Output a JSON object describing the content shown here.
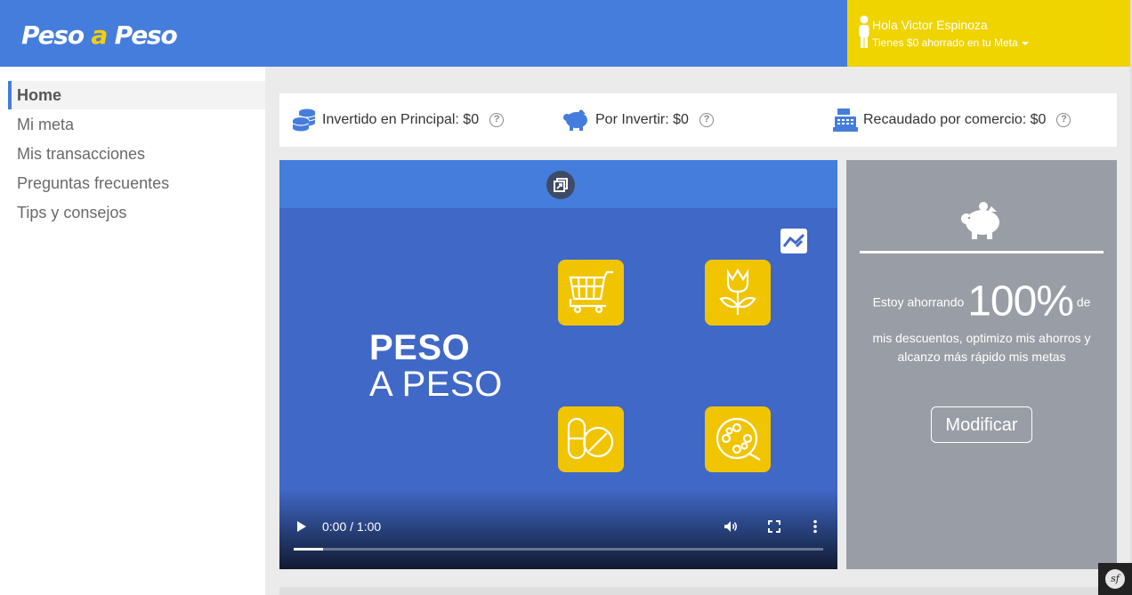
{
  "header": {
    "logo": {
      "part1": "Peso ",
      "part2": "a",
      "part3": " Peso"
    },
    "user": {
      "greeting": "Hola Victor Espinoza",
      "subtitle": "Tienes $0 ahorrado en tu Meta"
    }
  },
  "sidebar": {
    "items": [
      {
        "label": "Home",
        "active": true
      },
      {
        "label": "Mi meta"
      },
      {
        "label": "Mis transacciones"
      },
      {
        "label": "Preguntas frecuentes"
      },
      {
        "label": "Tips y consejos"
      }
    ]
  },
  "stats": [
    {
      "label": "Invertido en Principal: $0",
      "icon": "coins-stack-icon",
      "help": "?"
    },
    {
      "label": "Por Invertir: $0",
      "icon": "piggy-bank-icon",
      "help": "?"
    },
    {
      "label": "Recaudado por comercio: $0",
      "icon": "cash-register-icon",
      "help": "?"
    }
  ],
  "video": {
    "title_line1": "PESO",
    "title_line2": "A PESO",
    "time": "0:00 / 1:00",
    "progress": 0.055,
    "tiles": [
      "shopping-cart-icon",
      "flower-icon",
      "pills-icon",
      "film-reel-icon"
    ]
  },
  "savings": {
    "prefix": "Estoy ahorrando",
    "percent": "100%",
    "suffix": "de",
    "text": "mis descuentos, optimizo mis ahorros y alcanzo más rápido mis metas",
    "button": "Modificar"
  },
  "colors": {
    "primary": "#457ddc",
    "accent": "#efd400",
    "tile": "#f1c400",
    "card": "#999ea6"
  }
}
